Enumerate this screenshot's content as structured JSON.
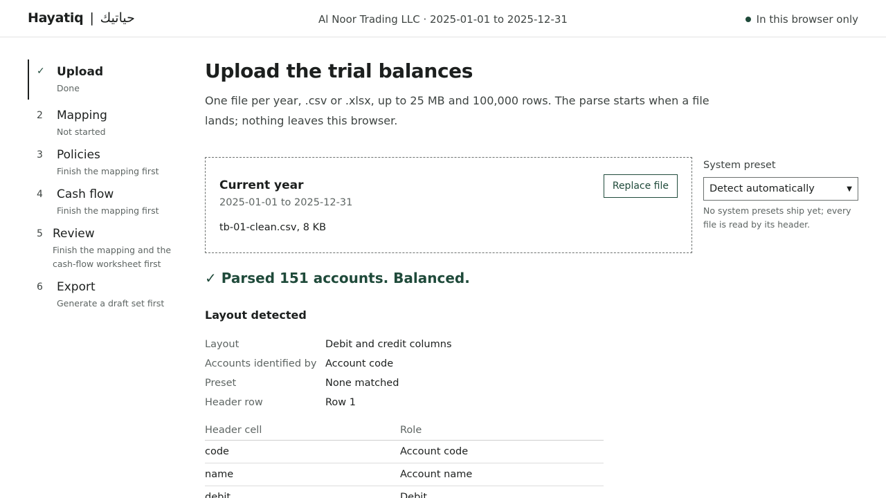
{
  "header": {
    "brand_latin": "Hayatiq",
    "brand_separator": "|",
    "brand_arabic": "حياتيك",
    "context": "Al Noor Trading LLC · 2025-01-01 to 2025-12-31",
    "local_note": "In this browser only"
  },
  "steps": [
    {
      "marker": "✓",
      "name": "Upload",
      "status": "Done"
    },
    {
      "marker": "2",
      "name": "Mapping",
      "status": "Not started"
    },
    {
      "marker": "3",
      "name": "Policies",
      "status": "Finish the mapping first"
    },
    {
      "marker": "4",
      "name": "Cash flow",
      "status": "Finish the mapping first"
    },
    {
      "marker": "5",
      "name": "Review",
      "status": "Finish the mapping and the cash-flow worksheet first"
    },
    {
      "marker": "6",
      "name": "Export",
      "status": "Generate a draft set first"
    }
  ],
  "main": {
    "title": "Upload the trial balances",
    "intro": "One file per year, .csv or .xlsx, up to 25 MB and 100,000 rows. The parse starts when a file lands; nothing leaves this browser.",
    "dropzone": {
      "title": "Current year",
      "period": "2025-01-01 to 2025-12-31",
      "file": "tb-01-clean.csv, 8 KB",
      "replace_label": "Replace file"
    },
    "preset": {
      "label": "System preset",
      "selected": "Detect automatically",
      "help": "No system presets ship yet; every file is read by its header."
    },
    "result": {
      "check": "✓",
      "text": "Parsed 151 accounts. Balanced."
    },
    "layout_heading": "Layout detected",
    "facts": [
      {
        "key": "Layout",
        "value": "Debit and credit columns"
      },
      {
        "key": "Accounts identified by",
        "value": "Account code"
      },
      {
        "key": "Preset",
        "value": "None matched"
      },
      {
        "key": "Header row",
        "value": "Row 1"
      }
    ],
    "header_table": {
      "columns": [
        "Header cell",
        "Role"
      ],
      "rows": [
        [
          "code",
          "Account code"
        ],
        [
          "name",
          "Account name"
        ],
        [
          "debit",
          "Debit"
        ]
      ]
    }
  }
}
